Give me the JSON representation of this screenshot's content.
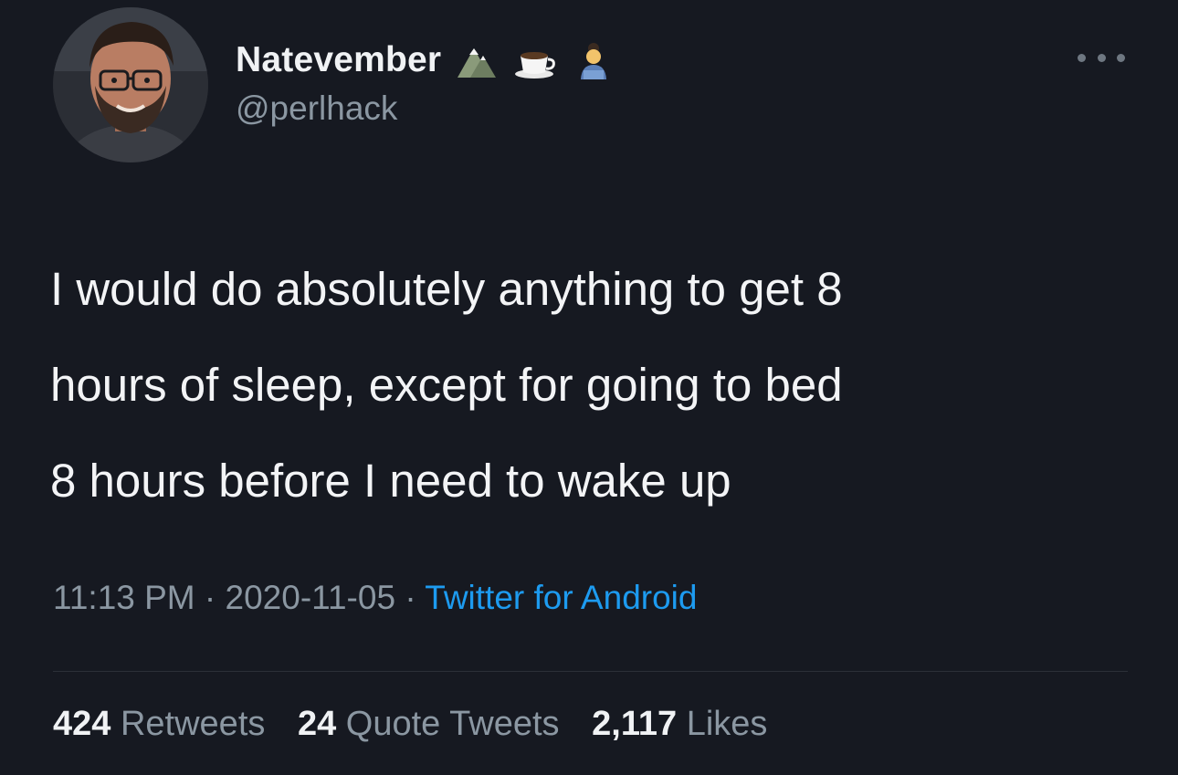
{
  "tweet": {
    "author": {
      "display_name": "Natevember",
      "handle": "@perlhack",
      "name_emojis": [
        "mountain-icon",
        "coffee-icon",
        "person-icon"
      ]
    },
    "text": "I would do absolutely anything to get 8\nhours of sleep, except for going to bed\n8 hours before I need to wake up",
    "time": "11:13 PM",
    "separator": "·",
    "date": "2020-11-05",
    "source": "Twitter for Android",
    "stats": {
      "retweets_count": "424",
      "retweets_label": "Retweets",
      "quotes_count": "24",
      "quotes_label": "Quote Tweets",
      "likes_count": "2,117",
      "likes_label": "Likes"
    }
  },
  "colors": {
    "background": "#161921",
    "text": "#f3f4f6",
    "secondary": "#8b97a2",
    "link": "#1d9bf0"
  }
}
